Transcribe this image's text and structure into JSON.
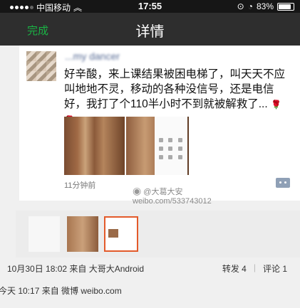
{
  "status_bar": {
    "carrier": "中国移动",
    "time": "17:55",
    "battery": "83%",
    "battery_level": 0.83
  },
  "nav": {
    "done_label": "完成",
    "title": "详情"
  },
  "post": {
    "username": "...my dancer",
    "content": "好辛酸，来上课结果被困电梯了，叫天天不应叫地地不灵，移动的各种没信号，还是电信好，我打了个110半小时不到就被解救了...",
    "rose_icons": "🌹 🌹",
    "time_ago": "11分钟前",
    "photos": [
      "elevator-door-photo",
      "elevator-door-photo-2",
      "phone-keypad-photo"
    ]
  },
  "watermark": {
    "handle": "@大葛大安",
    "url": "weibo.com/533743012"
  },
  "retweet": {
    "date_source": "10月30日 18:02 来自 大哥大Android",
    "repost": "转发 4",
    "comment": "评论 1"
  },
  "original": {
    "date_source": "今天 10:17 来自 微博 weibo.com"
  },
  "colors": {
    "nav_bg": "#2e2e2e",
    "done_green": "#1ab345",
    "username_blue": "#576b95"
  }
}
